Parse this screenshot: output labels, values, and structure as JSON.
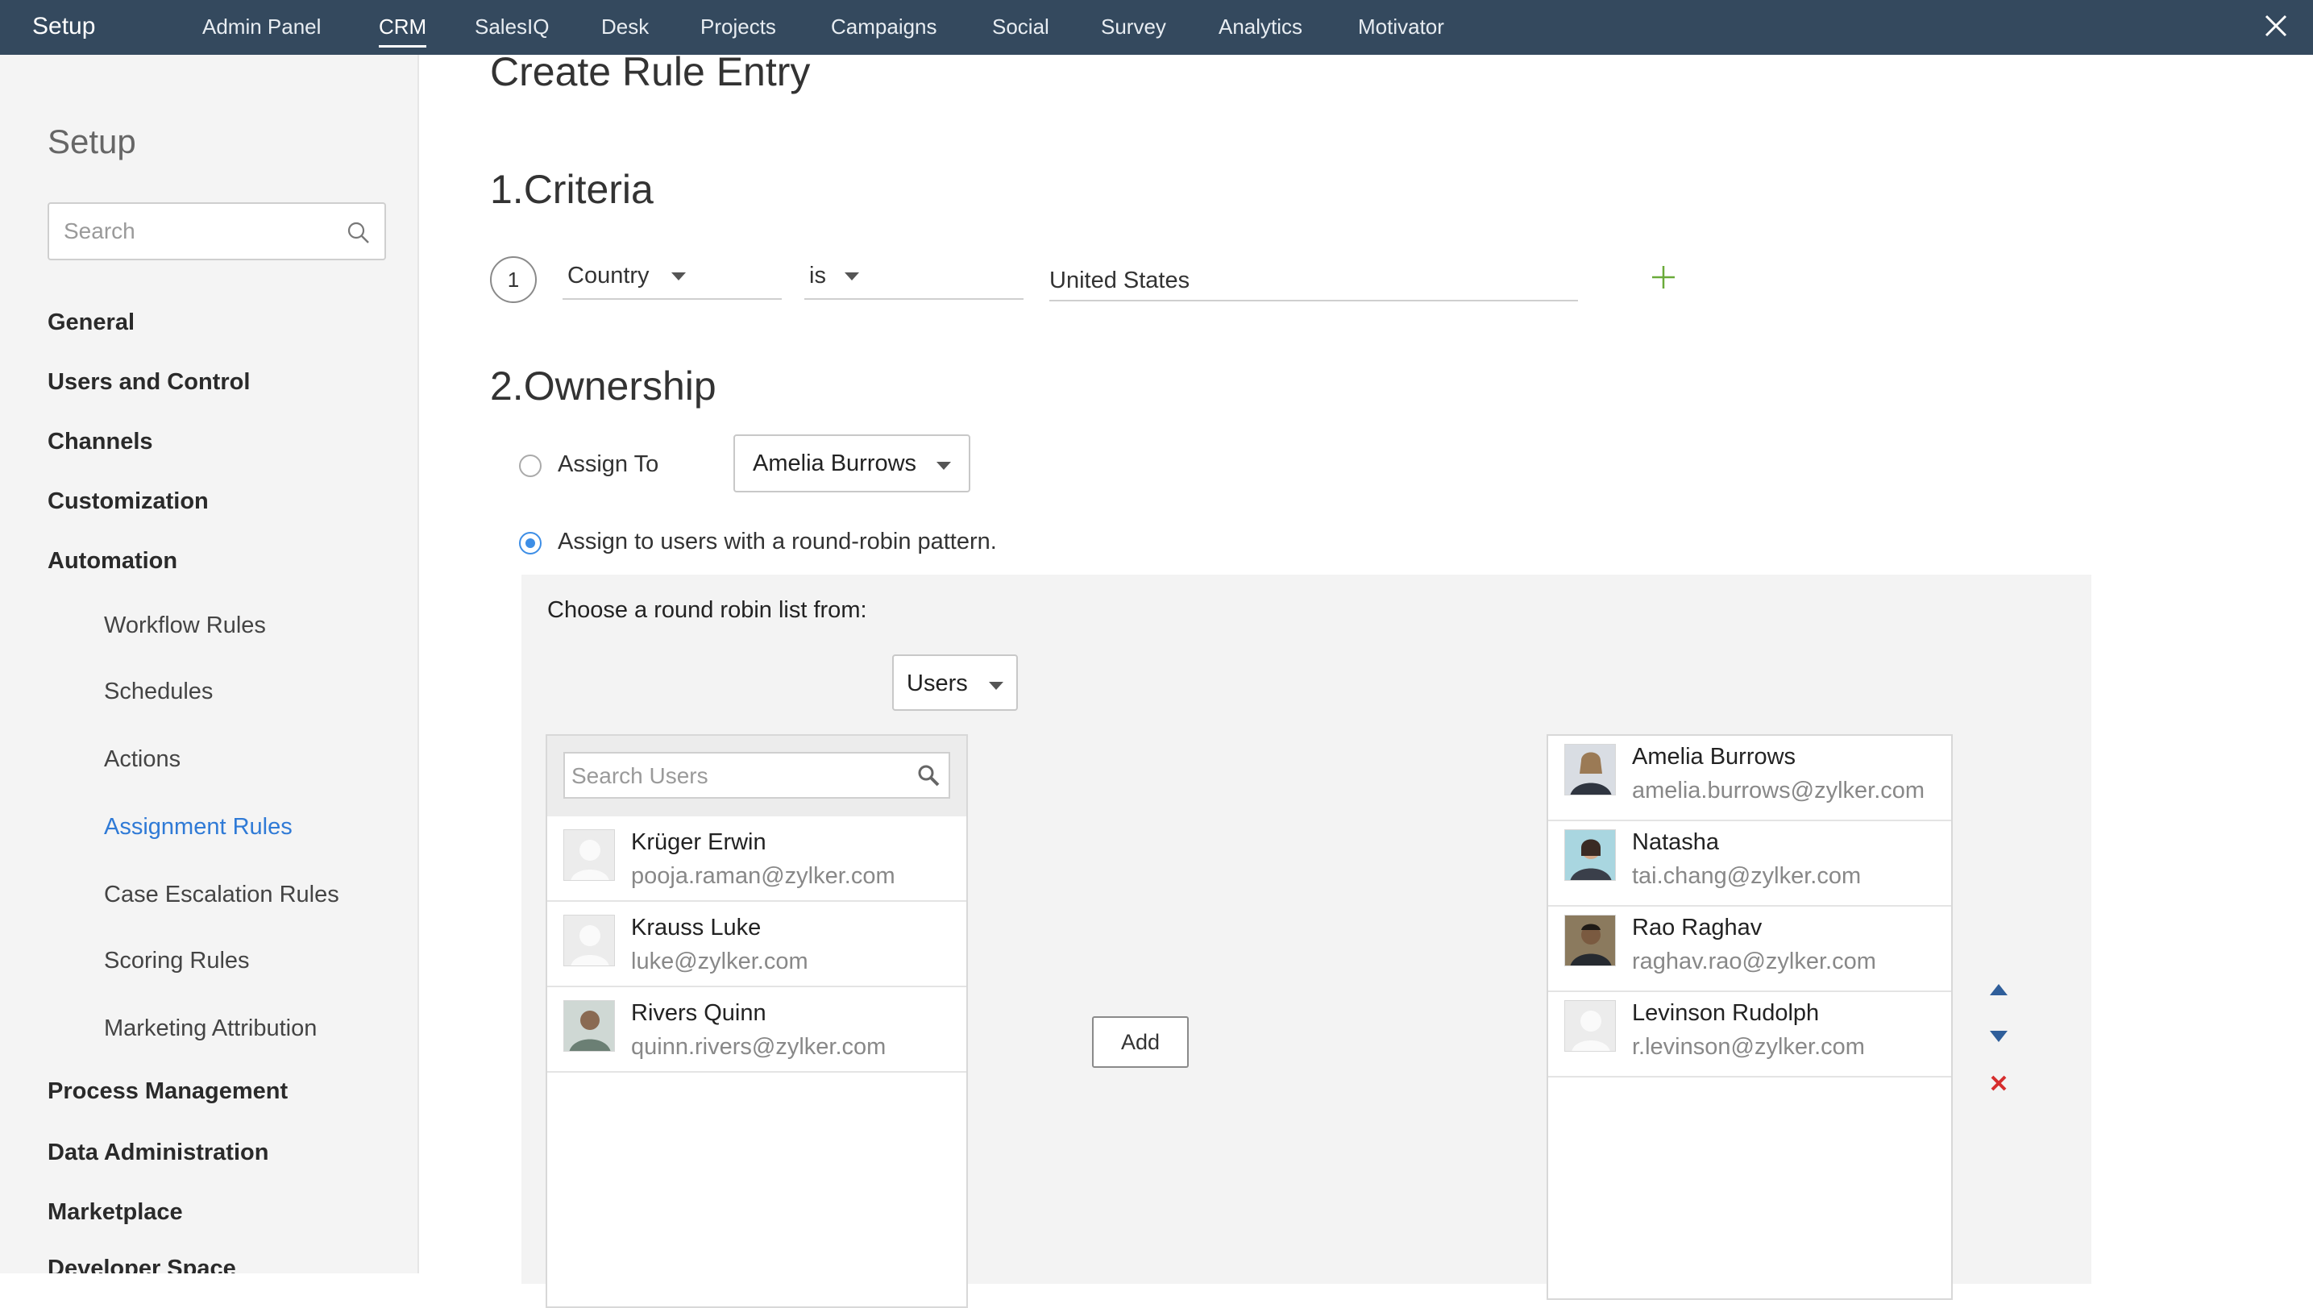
{
  "topbar": {
    "brand": "Setup",
    "tabs": [
      {
        "label": "Admin Panel"
      },
      {
        "label": "CRM"
      },
      {
        "label": "SalesIQ"
      },
      {
        "label": "Desk"
      },
      {
        "label": "Projects"
      },
      {
        "label": "Campaigns"
      },
      {
        "label": "Social"
      },
      {
        "label": "Survey"
      },
      {
        "label": "Analytics"
      },
      {
        "label": "Motivator"
      }
    ],
    "active_tab": "CRM",
    "close_icon": "close-icon"
  },
  "sidebar": {
    "title": "Setup",
    "search_placeholder": "Search",
    "items": [
      {
        "label": "General"
      },
      {
        "label": "Users and Control"
      },
      {
        "label": "Channels"
      },
      {
        "label": "Customization"
      },
      {
        "label": "Automation"
      },
      {
        "label": "Workflow Rules"
      },
      {
        "label": "Schedules"
      },
      {
        "label": "Actions"
      },
      {
        "label": "Assignment Rules"
      },
      {
        "label": "Case Escalation Rules"
      },
      {
        "label": "Scoring Rules"
      },
      {
        "label": "Marketing Attribution"
      },
      {
        "label": "Process Management"
      },
      {
        "label": "Data Administration"
      },
      {
        "label": "Marketplace"
      },
      {
        "label": "Developer Space"
      }
    ],
    "active_item": "Assignment Rules"
  },
  "main": {
    "title": "Create Rule Entry",
    "criteria": {
      "heading": "1.Criteria",
      "row_number": "1",
      "field": "Country",
      "operator": "is",
      "value": "United States"
    },
    "ownership": {
      "heading": "2.Ownership",
      "assign_to_label": "Assign To",
      "assign_to_value": "Amelia Burrows",
      "round_robin_label": "Assign to users with a round-robin pattern.",
      "selected_option": "round-robin",
      "round_robin": {
        "choose_label": "Choose a round robin list from:",
        "list_source": "Users",
        "search_placeholder": "Search Users",
        "add_button": "Add",
        "available_users": [
          {
            "name": "Krüger Erwin",
            "email": "pooja.raman@zylker.com",
            "avatar": "placeholder"
          },
          {
            "name": "Krauss Luke",
            "email": "luke@zylker.com",
            "avatar": "placeholder"
          },
          {
            "name": "Rivers Quinn",
            "email": "quinn.rivers@zylker.com",
            "avatar": "photo"
          }
        ],
        "selected_users": [
          {
            "name": "Amelia Burrows",
            "email": "amelia.burrows@zylker.com",
            "avatar": "photo"
          },
          {
            "name": "Natasha",
            "email": "tai.chang@zylker.com",
            "avatar": "photo"
          },
          {
            "name": "Rao Raghav",
            "email": "raghav.rao@zylker.com",
            "avatar": "photo"
          },
          {
            "name": "Levinson Rudolph",
            "email": "r.levinson@zylker.com",
            "avatar": "placeholder"
          }
        ],
        "controls": [
          "move-up-icon",
          "move-down-icon",
          "remove-icon"
        ]
      }
    }
  },
  "colors": {
    "topbar": "#34495e",
    "accent": "#2f7ad6",
    "radio": "#3d8ee6",
    "plus": "#6aaa3a",
    "remove": "#d62d2d",
    "arrows": "#2f5e9a"
  }
}
